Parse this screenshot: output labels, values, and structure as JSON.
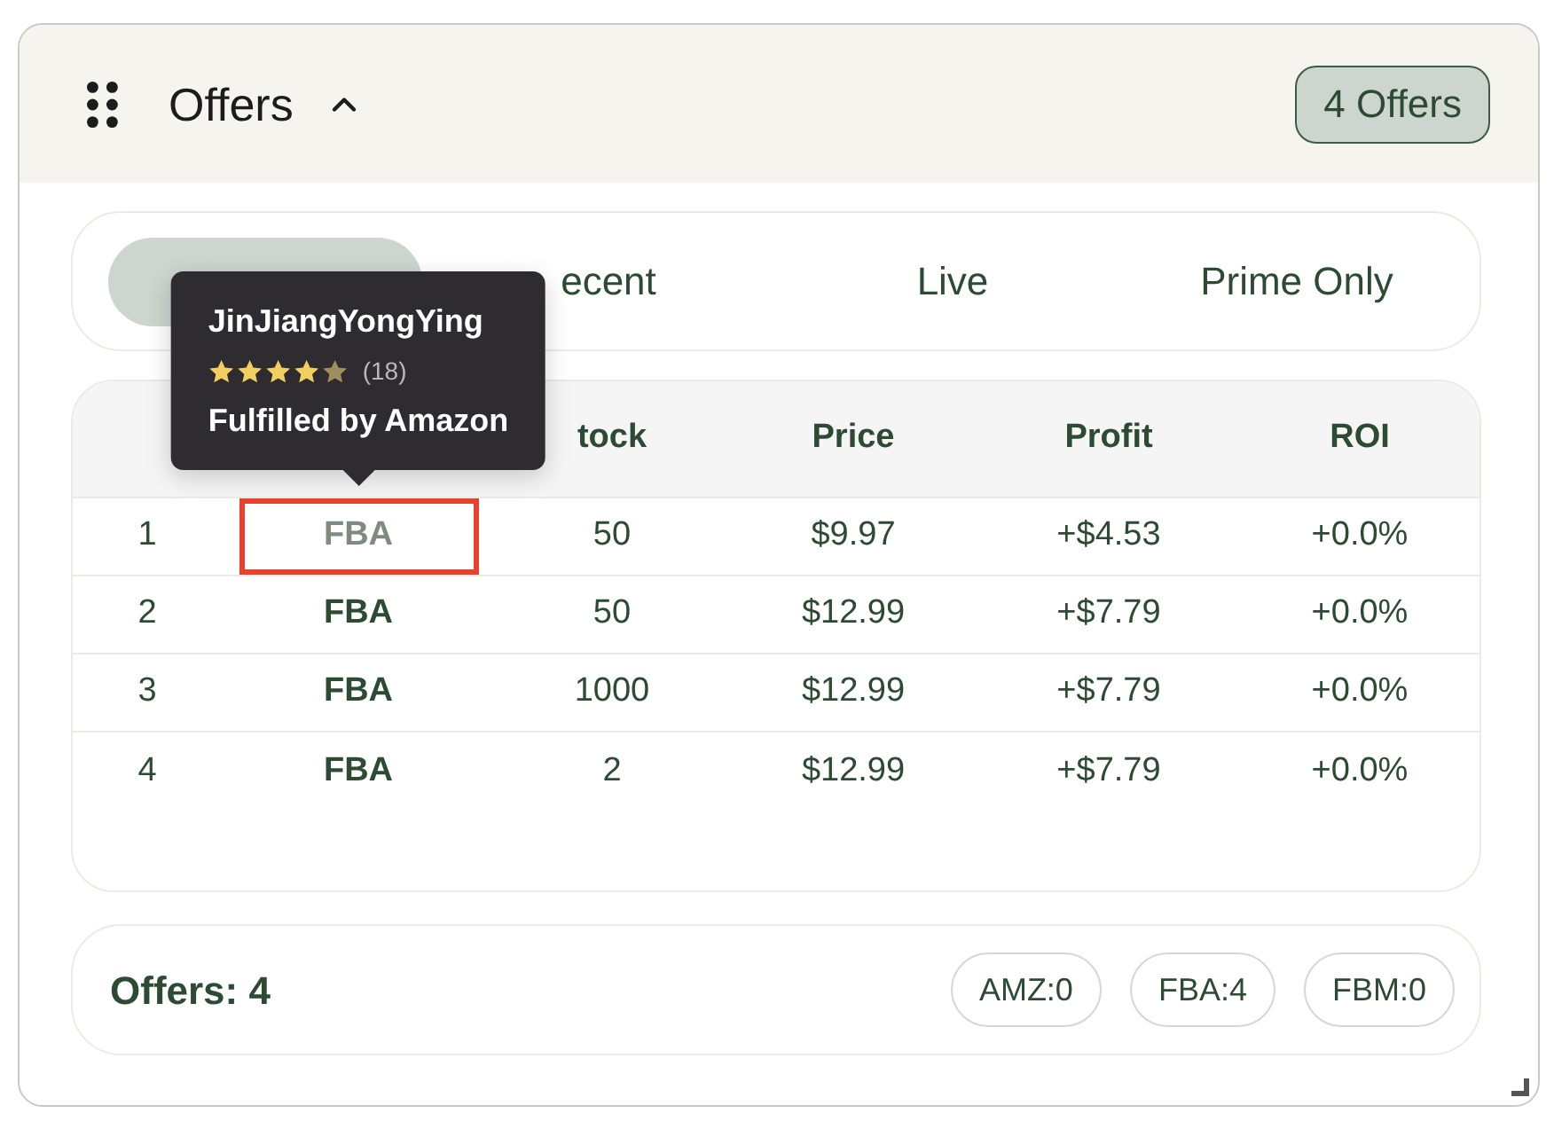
{
  "panel": {
    "title": "Offers",
    "expanded": true,
    "badge": "4 Offers"
  },
  "tabs": [
    {
      "selected": true
    },
    {
      "label": "ecent",
      "selected": false
    },
    {
      "label": "Live",
      "selected": false
    },
    {
      "label": "Prime Only",
      "selected": false
    }
  ],
  "table": {
    "columns": [
      "",
      "",
      "tock",
      "Price",
      "Profit",
      "ROI"
    ],
    "rows": [
      {
        "cells": [
          "1",
          "FBA",
          "50",
          "$9.97",
          "+$4.53",
          "+0.0%"
        ],
        "highlighted": true
      },
      {
        "cells": [
          "2",
          "FBA",
          "50",
          "$12.99",
          "+$7.79",
          "+0.0%"
        ],
        "highlighted": false
      },
      {
        "cells": [
          "3",
          "FBA",
          "1000",
          "$12.99",
          "+$7.79",
          "+0.0%"
        ],
        "highlighted": false
      },
      {
        "cells": [
          "4",
          "FBA",
          "2",
          "$12.99",
          "+$7.79",
          "+0.0%"
        ],
        "highlighted": false
      }
    ]
  },
  "tooltip": {
    "seller": "JinJiangYongYing",
    "stars": 4,
    "rating_count": "(18)",
    "fulfillment": "Fulfilled by Amazon"
  },
  "footer": {
    "summary": "Offers: 4",
    "counts": [
      "AMZ:0",
      "FBA:4",
      "FBM:0"
    ]
  }
}
